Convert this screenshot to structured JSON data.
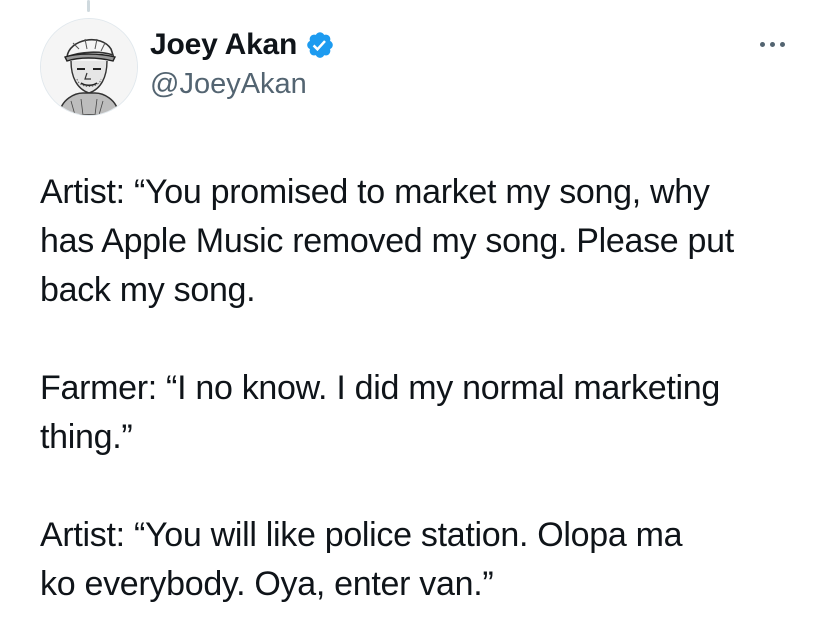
{
  "tweet": {
    "author": {
      "display_name": "Joey Akan",
      "handle": "@JoeyAkan",
      "verified": true,
      "avatar": "avatar-illustration",
      "verified_icon": "verified-badge-icon",
      "verified_color": "#1d9bf0"
    },
    "more_icon": "more-dots-icon",
    "paragraphs": [
      "Artist: “You promised to market my song, why\nhas Apple Music removed my song. Please put\nback my song.",
      "Farmer: “I no know. I did my normal marketing\nthing.”",
      "Artist: “You will like police station. Olopa ma\nko everybody. Oya, enter van.”"
    ]
  },
  "colors": {
    "text_primary": "#0f1419",
    "text_secondary": "#536471",
    "thread_line": "#cfd9de"
  }
}
